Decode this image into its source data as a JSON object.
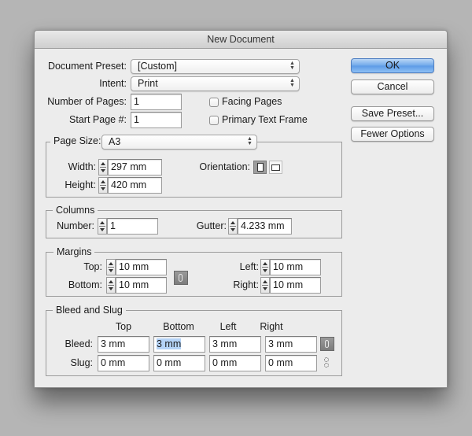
{
  "window": {
    "title": "New Document"
  },
  "general": {
    "document_preset": {
      "label": "Document Preset:",
      "value": "[Custom]"
    },
    "intent": {
      "label": "Intent:",
      "value": "Print"
    },
    "number_of_pages": {
      "label": "Number of Pages:",
      "value": "1"
    },
    "start_page": {
      "label": "Start Page #:",
      "value": "1"
    },
    "facing_pages": {
      "label": "Facing Pages",
      "checked": false
    },
    "primary_text_frame": {
      "label": "Primary Text Frame",
      "checked": false
    }
  },
  "buttons": {
    "ok": "OK",
    "cancel": "Cancel",
    "save_preset": "Save Preset...",
    "fewer_options": "Fewer Options"
  },
  "page_size": {
    "label": "Page Size:",
    "value": "A3",
    "width": {
      "label": "Width:",
      "value": "297 mm"
    },
    "height": {
      "label": "Height:",
      "value": "420 mm"
    },
    "orientation": {
      "label": "Orientation:",
      "options": [
        "Portrait",
        "Landscape"
      ],
      "selected": "Portrait"
    }
  },
  "columns": {
    "title": "Columns",
    "number": {
      "label": "Number:",
      "value": "1"
    },
    "gutter": {
      "label": "Gutter:",
      "value": "4.233 mm"
    }
  },
  "margins": {
    "title": "Margins",
    "top": {
      "label": "Top:",
      "value": "10 mm"
    },
    "bottom": {
      "label": "Bottom:",
      "value": "10 mm"
    },
    "left": {
      "label": "Left:",
      "value": "10 mm"
    },
    "right": {
      "label": "Right:",
      "value": "10 mm"
    },
    "linked": true
  },
  "bleed_slug": {
    "title": "Bleed and Slug",
    "columns": [
      "Top",
      "Bottom",
      "Left",
      "Right"
    ],
    "bleed": {
      "label": "Bleed:",
      "values": [
        "3 mm",
        "3 mm",
        "3 mm",
        "3 mm"
      ],
      "linked": true
    },
    "slug": {
      "label": "Slug:",
      "values": [
        "0 mm",
        "0 mm",
        "0 mm",
        "0 mm"
      ],
      "linked": false
    }
  },
  "colors": {
    "primary_button": "#5c9ae6",
    "selection": "#b5d3f6",
    "background": "#ececec"
  }
}
